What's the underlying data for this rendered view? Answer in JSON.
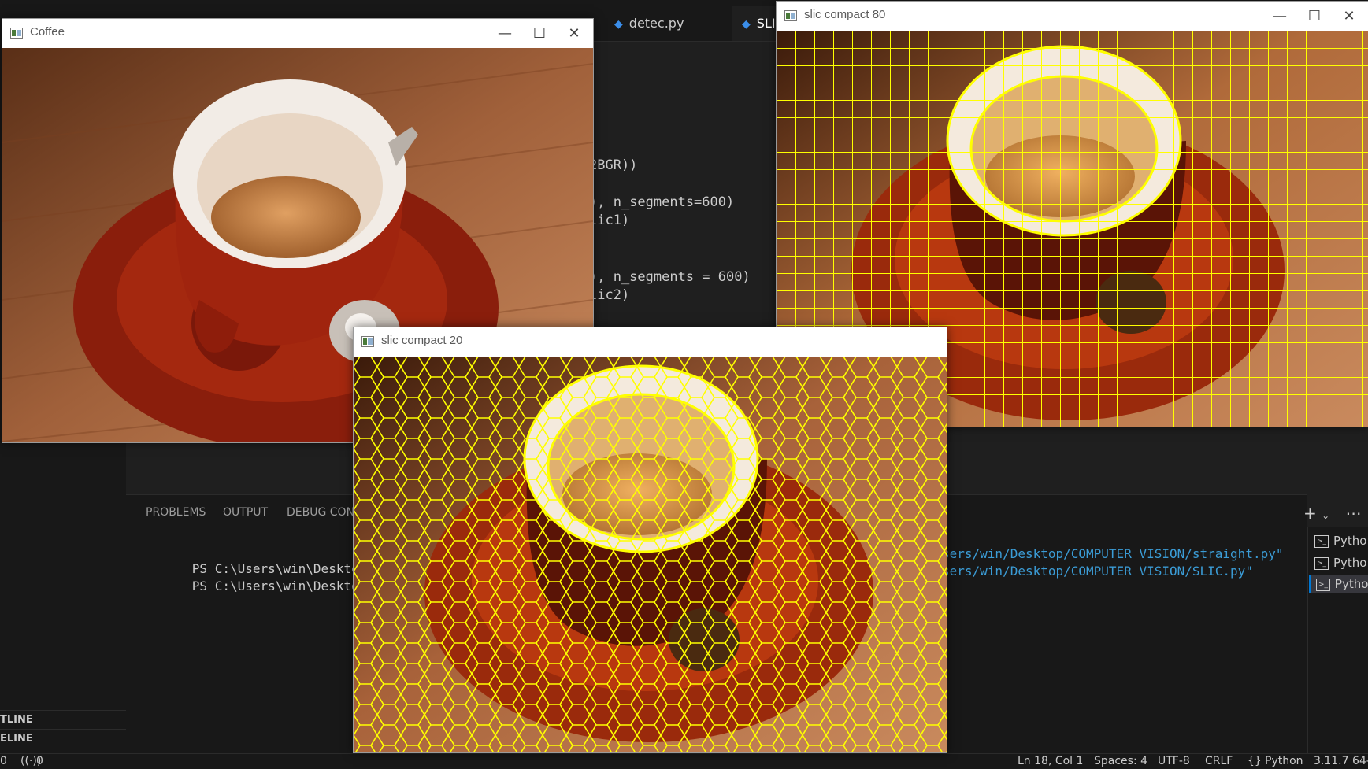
{
  "vscode": {
    "tabs": [
      {
        "label": "detec.py"
      },
      {
        "label": "SLIC"
      }
    ],
    "code": [
      {
        "text": "2BGR))"
      },
      {
        "text": "), n_segments=600)"
      },
      {
        "text": "lic1)"
      },
      {
        "text": "), n_segments = 600)"
      },
      {
        "text": "lic2)"
      }
    ],
    "panel_tabs": [
      "PROBLEMS",
      "OUTPUT",
      "DEBUG CONS"
    ],
    "terminal": [
      {
        "prompt": "PS C:\\Users\\win\\Desktop\\COMPU",
        "path": "sers/win/Desktop/COMPUTER VISION/straight.py\""
      },
      {
        "prompt": "PS C:\\Users\\win\\Desktop\\COMPU",
        "path": "sers/win/Desktop/COMPUTER VISION/SLIC.py\""
      }
    ],
    "terminal_list": [
      "Pytho",
      "Pytho",
      "Pytho"
    ],
    "outline": [
      "TLINE",
      "ELINE"
    ],
    "status": {
      "left_a": "0",
      "left_b": "0",
      "ln_col": "Ln 18, Col 1",
      "spaces": "Spaces: 4",
      "encoding": "UTF-8",
      "eol": "CRLF",
      "language": "Python",
      "interpreter": "3.11.7 64-b"
    }
  },
  "windows": {
    "coffee": {
      "title": "Coffee"
    },
    "slic20": {
      "title": "slic compact 20"
    },
    "slic80": {
      "title": "slic compact 80"
    }
  },
  "colors": {
    "overlay": "#ffff00",
    "saucer": "#8a1e0c",
    "wood": "#9a5a35"
  }
}
